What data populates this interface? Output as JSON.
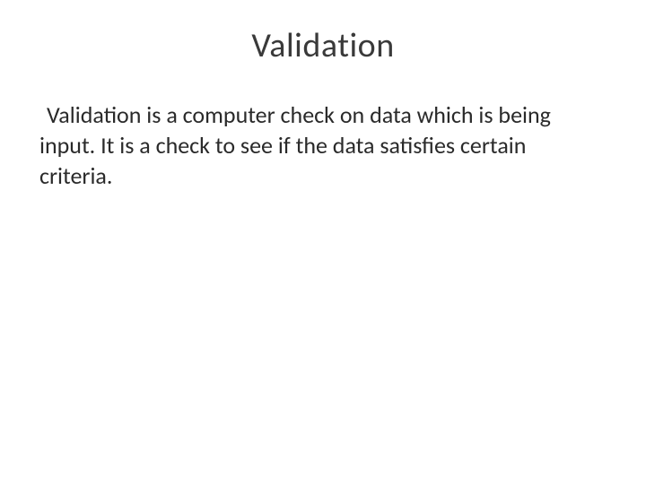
{
  "slide": {
    "title": "Validation",
    "body": "Validation is a computer check on data which is being input. It is a check to see if the data satisfies certain criteria."
  }
}
